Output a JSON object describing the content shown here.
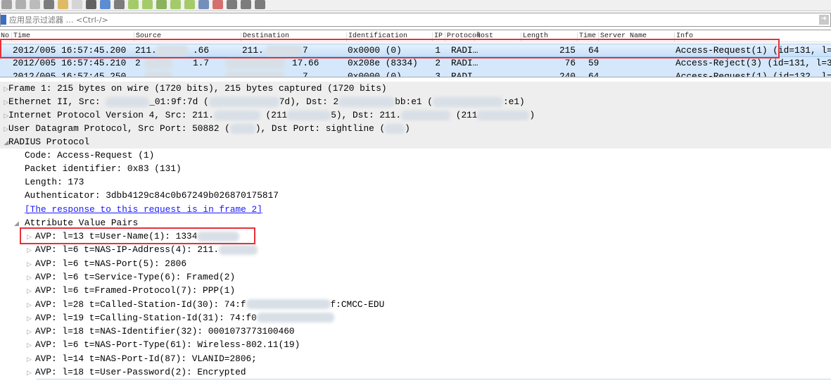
{
  "toolbar": {
    "icons": [
      "stop-icon",
      "restart-icon",
      "options-icon",
      "open-icon",
      "save-icon",
      "close-file-icon",
      "reload-icon",
      "find-icon",
      "back-icon",
      "forward-icon",
      "goto-icon",
      "first-icon",
      "last-icon",
      "autoscroll-icon",
      "colorize-icon",
      "zoom-in-icon",
      "zoom-out-icon",
      "zoom-normal-icon",
      "resize-columns-icon"
    ]
  },
  "filter": {
    "placeholder": "应用显示过滤器 … <Ctrl-/>"
  },
  "columns": [
    "No",
    "Time",
    "Source",
    "Destination",
    "Identification",
    "IP",
    "Protocol",
    "Host",
    "Length",
    "Time",
    "Server Name",
    "Info"
  ],
  "packets": [
    {
      "time": "2012/005 16:57:45.200",
      "source": "211.",
      "source_tail": ".66",
      "destination": "211.",
      "destination_tail": "7",
      "identification": "0x0000 (0)",
      "ip": "1",
      "protocol": "RADI…",
      "length": "215",
      "ttl": "64",
      "info": "Access-Request(1) (id=131, l="
    },
    {
      "time": "2012/005 16:57:45.210",
      "source": "2",
      "source_tail": "1.7",
      "destination": "",
      "destination_tail": "17.66",
      "identification": "0x208e (8334)",
      "ip": "2",
      "protocol": "RADI…",
      "length": "76",
      "ttl": "59",
      "info": "Access-Reject(3) (id=131, l=3"
    },
    {
      "time": "2012/005 16:57:45.250",
      "source": "",
      "source_tail": "",
      "destination": "",
      "destination_tail": "7",
      "identification": "0x0000 (0)",
      "ip": "3",
      "protocol": "RADI…",
      "length": "240",
      "ttl": "64",
      "info": "Access-Request(1) (id=132, l="
    }
  ],
  "details": {
    "frame": "Frame 1: 215 bytes on wire (1720 bits), 215 bytes captured (1720 bits)",
    "eth_a": "Ethernet II, Src: ",
    "eth_b": "_01:9f:7d (",
    "eth_c": "7d), Dst: 2",
    "eth_d": "bb:e1 (",
    "eth_e": ":e1)",
    "ip_a": "Internet Protocol Version 4, Src: 211.",
    "ip_b": "(211",
    "ip_c": "5), Dst: 211.",
    "ip_d": "(211",
    "ip_e": ")",
    "udp_a": "User Datagram Protocol, Src Port: 50882 (",
    "udp_b": "), Dst Port: sightline (",
    "udp_c": ")",
    "radius": "RADIUS Protocol",
    "code": "Code: Access-Request (1)",
    "pid": "Packet identifier: 0x83 (131)",
    "length": "Length: 173",
    "auth": "Authenticator: 3dbb4129c84c0b67249b026870175817",
    "response_link": "[The response to this request is in frame 2]",
    "avp_header": "Attribute Value Pairs",
    "avps": [
      "AVP: l=13 t=User-Name(1): 1334",
      "AVP: l=6 t=NAS-IP-Address(4): 211.",
      "AVP: l=6 t=NAS-Port(5): 2806",
      "AVP: l=6 t=Service-Type(6): Framed(2)",
      "AVP: l=6 t=Framed-Protocol(7): PPP(1)",
      "AVP: l=28 t=Called-Station-Id(30): 74:f",
      "AVP: l=19 t=Calling-Station-Id(31): 74:f0",
      "AVP: l=18 t=NAS-Identifier(32): 0001073773100460",
      "AVP: l=6 t=NAS-Port-Type(61): Wireless-802.11(19)",
      "AVP: l=14 t=NAS-Port-Id(87): VLANID=2806;",
      "AVP: l=18 t=User-Password(2): Encrypted"
    ],
    "called_tail": "f:CMCC-EDU"
  },
  "colors": {
    "selected_row": "#c6e0f9",
    "row": "#d5e8fb",
    "highlight_box": "#e8303a",
    "link": "#1a1aff"
  }
}
